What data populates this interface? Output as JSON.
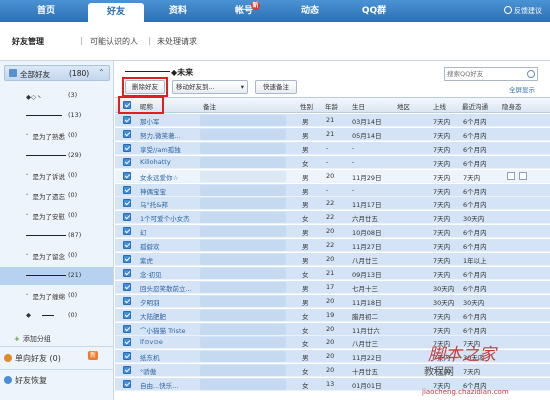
{
  "nav": {
    "items": [
      {
        "label": "首页",
        "badge": ""
      },
      {
        "label": "好友",
        "badge": ""
      },
      {
        "label": "资料",
        "badge": ""
      },
      {
        "label": "帐号",
        "badge": "新"
      },
      {
        "label": "动态",
        "badge": ""
      },
      {
        "label": "QQ群",
        "badge": ""
      }
    ],
    "active_index": 1,
    "feedback": "反馈建议"
  },
  "subnav": {
    "items": [
      "好友管理",
      "可能认识的人",
      "未处理请求"
    ],
    "separator": "|"
  },
  "sidebar": {
    "header_label": "全部好友",
    "header_count": "(180)",
    "groups": [
      {
        "label": "◆◇丶",
        "count": "(3)"
      },
      {
        "label": "",
        "count": "(13)"
      },
      {
        "label": "゛是为了熟悉",
        "count": "(0)"
      },
      {
        "label": "",
        "count": "(29)"
      },
      {
        "label": "゛是为了诉说",
        "count": "(0)"
      },
      {
        "label": "゛是为了遗忘",
        "count": "(0)"
      },
      {
        "label": "゛是为了安慰",
        "count": "(0)"
      },
      {
        "label": "",
        "count": "(87)"
      },
      {
        "label": "゛是为了留念",
        "count": "(0)"
      },
      {
        "label": "",
        "count": "(21)"
      },
      {
        "label": "゛是为了缠绵",
        "count": "(0)"
      },
      {
        "label": "◆",
        "count": "(0)"
      }
    ],
    "selected_group": 9,
    "add_group": "添加分组",
    "stranger": "单向好友",
    "stranger_count": "(0)",
    "stranger_badge": "新",
    "restore": "好友恢复"
  },
  "main": {
    "group_title": "◆未来",
    "delete_button": "删除好友",
    "move_select": "移动好友到...",
    "quick_note_button": "快速备注",
    "search_placeholder": "搜索QQ好友",
    "fullscreen": "全屏显示",
    "columns": [
      "昵称",
      "备注",
      "性别",
      "年龄",
      "生日",
      "地区",
      "上线",
      "最近沟通",
      "隐身态"
    ]
  },
  "table": [
    {
      "name": "那小军",
      "gender": "男",
      "age": "21",
      "birthday": "03月14日",
      "online": "7天内",
      "contact": "6个月内"
    },
    {
      "name": "努力,微笑著...",
      "gender": "男",
      "age": "21",
      "birthday": "05月14日",
      "online": "7天内",
      "contact": "6个月内"
    },
    {
      "name": "享受//am孤独",
      "gender": "男",
      "age": "-",
      "birthday": "-",
      "online": "7天内",
      "contact": "6个月内"
    },
    {
      "name": "Killohatty",
      "gender": "女",
      "age": "-",
      "birthday": "-",
      "online": "7天内",
      "contact": "6个月内"
    },
    {
      "name": "女永远爱你☆",
      "gender": "男",
      "age": "20",
      "birthday": "11月29日",
      "online": "7天内",
      "contact": "7天内"
    },
    {
      "name": "神偶宝宝",
      "gender": "男",
      "age": "-",
      "birthday": "-",
      "online": "7天内",
      "contact": "6个月内"
    },
    {
      "name": "乌°托&邦",
      "gender": "男",
      "age": "22",
      "birthday": "11月17日",
      "online": "7天内",
      "contact": "6个月内"
    },
    {
      "name": "1个可爱个小女杰",
      "gender": "女",
      "age": "22",
      "birthday": "六月廿五",
      "online": "7天内",
      "contact": "30天内"
    },
    {
      "name": "幻",
      "gender": "男",
      "age": "20",
      "birthday": "10月08日",
      "online": "7天内",
      "contact": "6个月内"
    },
    {
      "name": "孤僻欢",
      "gender": "男",
      "age": "22",
      "birthday": "11月27日",
      "online": "7天内",
      "contact": "6个月内"
    },
    {
      "name": "紫虎",
      "gender": "男",
      "age": "20",
      "birthday": "八月廿三",
      "online": "7天内",
      "contact": "1年以上"
    },
    {
      "name": "念·初见",
      "gender": "女",
      "age": "21",
      "birthday": "09月13日",
      "online": "7天内",
      "contact": "6个月内"
    },
    {
      "name": "回头忍笑散前立...",
      "gender": "男",
      "age": "17",
      "birthday": "七月十三",
      "online": "30天内",
      "contact": "6个月内"
    },
    {
      "name": "夕明羽",
      "gender": "男",
      "age": "20",
      "birthday": "11月18日",
      "online": "30天内",
      "contact": "30天内"
    },
    {
      "name": "大陆肥肥",
      "gender": "女",
      "age": "19",
      "birthday": "腊月初二",
      "online": "7天内",
      "contact": "6个月内"
    },
    {
      "name": "⌒小猫猫 Triste",
      "gender": "女",
      "age": "20",
      "birthday": "11月廿六",
      "online": "7天内",
      "contact": "6个月内"
    },
    {
      "name": "lf⊙v⊙e",
      "gender": "女",
      "age": "20",
      "birthday": "八月廿三",
      "online": "7天内",
      "contact": "7天内"
    },
    {
      "name": "纸东机",
      "gender": "男",
      "age": "20",
      "birthday": "11月22日",
      "online": "7天内",
      "contact": "30天内"
    },
    {
      "name": "°骄傲",
      "gender": "女",
      "age": "20",
      "birthday": "十月廿五",
      "online": "7天内",
      "contact": "7天内"
    },
    {
      "name": "自由...快乐...",
      "gender": "女",
      "age": "13",
      "birthday": "01月01日",
      "online": "7天内",
      "contact": "6个月内"
    }
  ],
  "highlight_row": 4,
  "watermark": {
    "title": "脚本之家",
    "subtitle": "教程网",
    "url": "jiaocheng.chazidian.com"
  },
  "colors": {
    "nav_bg": "#2d6fb5",
    "row_bg": "#d4e4f6",
    "accent_red": "#e02020"
  }
}
